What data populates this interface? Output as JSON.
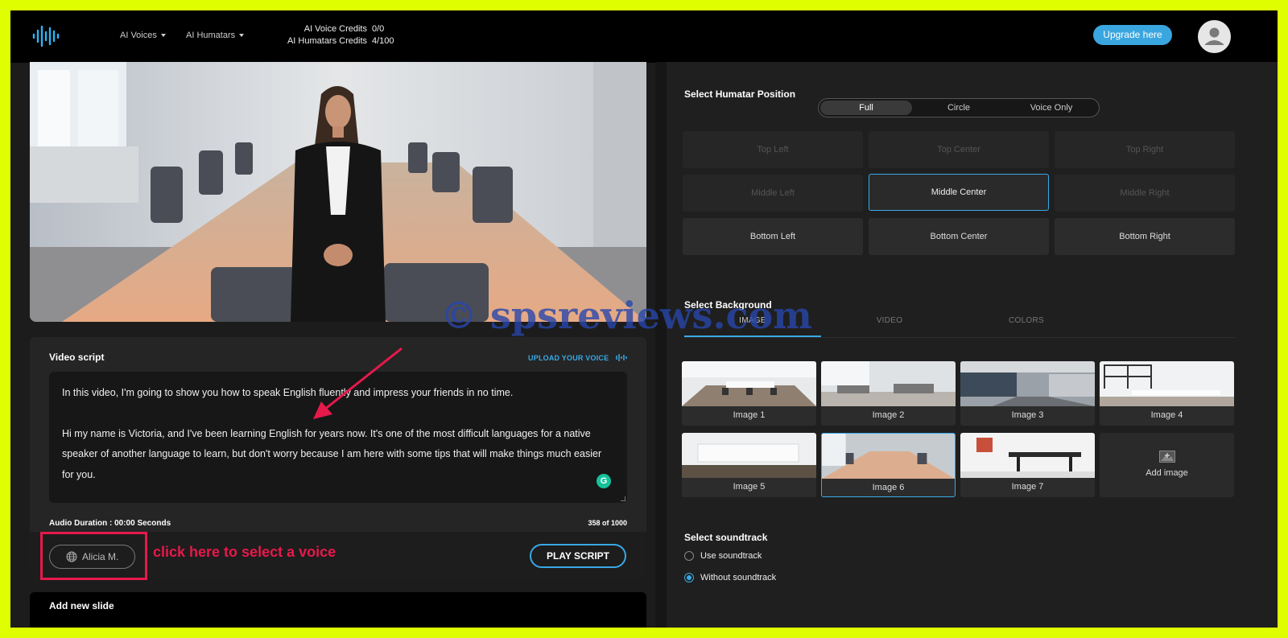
{
  "topbar": {
    "nav": [
      {
        "label": "AI Voices"
      },
      {
        "label": "AI Humatars"
      }
    ],
    "credits": [
      {
        "label": "AI Voice Credits",
        "value": "0/0"
      },
      {
        "label": "AI Humatars Credits",
        "value": "4/100"
      }
    ],
    "upgrade_label": "Upgrade here"
  },
  "script": {
    "title": "Video script",
    "upload_label": "UPLOAD YOUR VOICE",
    "paragraphs": [
      "In this video, I'm going to show you how to speak English fluently and impress your friends in no time.",
      "Hi my name is Victoria, and I've been learning English for years now. It's one of the most difficult languages for a native speaker of another language to learn, but don't worry because I am here with some tips that will make things much easier for you."
    ],
    "duration": "Audio Duration : 00:00 Seconds",
    "char_count": "358 of 1000",
    "voice_name": "Alicia M.",
    "annotation": "click here to select a voice",
    "play_label": "PLAY SCRIPT"
  },
  "new_slide": {
    "title": "Add new slide"
  },
  "position": {
    "title": "Select Humatar Position",
    "shapes": [
      "Full",
      "Circle",
      "Voice Only"
    ],
    "active_shape": "Full",
    "cells": [
      {
        "label": "Top Left",
        "state": "disabled"
      },
      {
        "label": "Top Center",
        "state": "disabled"
      },
      {
        "label": "Top Right",
        "state": "disabled"
      },
      {
        "label": "Middle Left",
        "state": "disabled"
      },
      {
        "label": "Middle Center",
        "state": "active"
      },
      {
        "label": "Middle Right",
        "state": "disabled"
      },
      {
        "label": "Bottom Left",
        "state": "enabled"
      },
      {
        "label": "Bottom Center",
        "state": "enabled"
      },
      {
        "label": "Bottom Right",
        "state": "enabled"
      }
    ]
  },
  "background": {
    "title": "Select Background",
    "tabs": [
      "IMAGE",
      "VIDEO",
      "COLORS"
    ],
    "active_tab": "IMAGE",
    "images": [
      {
        "label": "Image 1"
      },
      {
        "label": "Image 2"
      },
      {
        "label": "Image 3"
      },
      {
        "label": "Image 4"
      },
      {
        "label": "Image 5"
      },
      {
        "label": "Image 6"
      },
      {
        "label": "Image 7"
      }
    ],
    "selected_image": "Image 6",
    "add_label": "Add image"
  },
  "soundtrack": {
    "title": "Select soundtrack",
    "options": [
      "Use soundtrack",
      "Without soundtrack"
    ],
    "selected": "Without soundtrack"
  },
  "watermark": "© spsreviews.com",
  "colors": {
    "accent": "#39a9e6",
    "annotation": "#e6194b",
    "frame": "#dfff00"
  }
}
